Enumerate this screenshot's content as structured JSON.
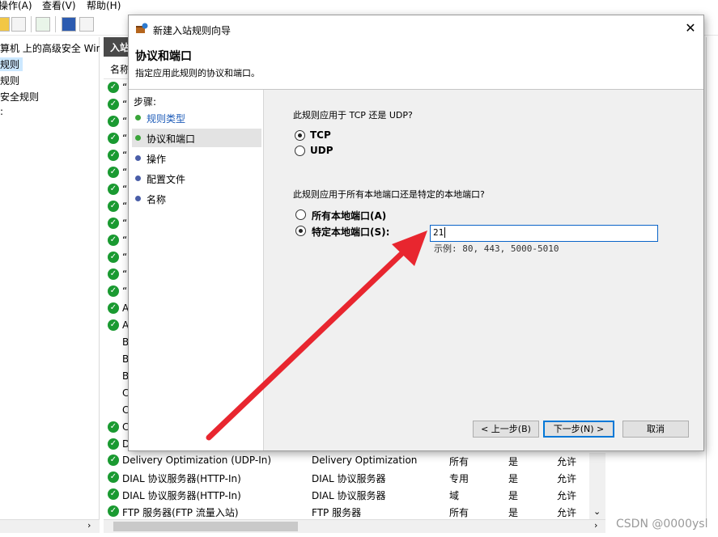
{
  "menu": [
    "操作(A)",
    "查看(V)",
    "帮助(H)"
  ],
  "tree": [
    "算机 上的高级安全 Win",
    "规则",
    "规则",
    "安全规则",
    ":"
  ],
  "center": {
    "header": "入站",
    "col_name": "名称"
  },
  "rows_partial": [
    "“",
    "“",
    "“",
    "“",
    "“",
    "“",
    "“",
    "“",
    "“",
    "“",
    "“",
    "“",
    "“",
    "A",
    "A",
    "B",
    "B",
    "B",
    "C",
    "C",
    "C",
    "D"
  ],
  "rows": [
    {
      "name": "Delivery Optimization (UDP-In)",
      "group": "Delivery Optimization",
      "profile": "所有",
      "enabled": "是",
      "action": "允许"
    },
    {
      "name": "DIAL 协议服务器(HTTP-In)",
      "group": "DIAL 协议服务器",
      "profile": "专用",
      "enabled": "是",
      "action": "允许"
    },
    {
      "name": "DIAL 协议服务器(HTTP-In)",
      "group": "DIAL 协议服务器",
      "profile": "域",
      "enabled": "是",
      "action": "允许"
    },
    {
      "name": "FTP 服务器(FTP 流量入站)",
      "group": "FTP 服务器",
      "profile": "所有",
      "enabled": "是",
      "action": "允许"
    }
  ],
  "watermark": "CSDN @0000ysl",
  "dialog": {
    "title": "新建入站规则向导",
    "heading": "协议和端口",
    "subheading": "指定应用此规则的协议和端口。",
    "steps_label": "步骤:",
    "steps": [
      {
        "label": "规则类型",
        "state": "done",
        "color": "#3aa53a"
      },
      {
        "label": "协议和端口",
        "state": "current",
        "color": "#3aa53a"
      },
      {
        "label": "操作",
        "state": "todo",
        "color": "#4a5ea8"
      },
      {
        "label": "配置文件",
        "state": "todo",
        "color": "#4a5ea8"
      },
      {
        "label": "名称",
        "state": "todo",
        "color": "#4a5ea8"
      }
    ],
    "q1": "此规则应用于 TCP 还是 UDP?",
    "protocols": [
      {
        "label": "TCP",
        "checked": true
      },
      {
        "label": "UDP",
        "checked": false
      }
    ],
    "q2": "此规则应用于所有本地端口还是特定的本地端口?",
    "ports_options": [
      {
        "label": "所有本地端口(A)",
        "checked": false
      },
      {
        "label": "特定本地端口(S):",
        "checked": true
      }
    ],
    "port_value": "21",
    "port_example": "示例: 80, 443, 5000-5010",
    "buttons": {
      "back": "< 上一步(B)",
      "next": "下一步(N) >",
      "cancel": "取消"
    }
  },
  "colors": {
    "arrow": "#e8262f",
    "check": "#1a9a31",
    "accent": "#0078d7"
  }
}
